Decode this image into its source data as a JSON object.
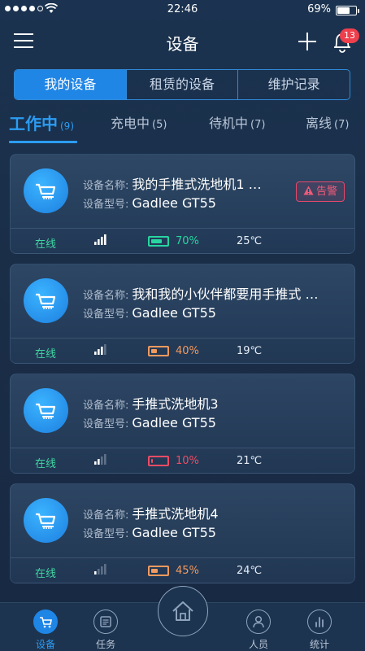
{
  "status_bar": {
    "time": "22:46",
    "battery_percent": "69%",
    "battery_level": 0.69
  },
  "header": {
    "title": "设备",
    "notification_count": "13"
  },
  "segment": [
    {
      "label": "我的设备",
      "active": true
    },
    {
      "label": "租赁的设备",
      "active": false
    },
    {
      "label": "维护记录",
      "active": false
    }
  ],
  "tabs": [
    {
      "label": "工作中",
      "count": "(9)",
      "active": true
    },
    {
      "label": "充电中",
      "count": "(5)",
      "active": false
    },
    {
      "label": "待机中",
      "count": "(7)",
      "active": false
    },
    {
      "label": "离线",
      "count": "(7)",
      "active": false
    }
  ],
  "labels": {
    "name": "设备名称:",
    "model": "设备型号:"
  },
  "devices": [
    {
      "name": "我的手推式洗地机1 …",
      "model": "Gadlee GT55",
      "status": "在线",
      "alarm": "告警",
      "battery": "70%",
      "battery_level": 0.7,
      "battery_color": "#27d6a0",
      "signal": 4,
      "temp": "25℃"
    },
    {
      "name": "我和我的小伙伴都要用手推式 …",
      "model": "Gadlee GT55",
      "status": "在线",
      "alarm": "",
      "battery": "40%",
      "battery_level": 0.4,
      "battery_color": "#f39a5e",
      "signal": 3,
      "temp": "19℃"
    },
    {
      "name": "手推式洗地机3",
      "model": "Gadlee GT55",
      "status": "在线",
      "alarm": "",
      "battery": "10%",
      "battery_level": 0.1,
      "battery_color": "#ef4c63",
      "signal": 2,
      "temp": "21℃"
    },
    {
      "name": "手推式洗地机4",
      "model": "Gadlee GT55",
      "status": "在线",
      "alarm": "",
      "battery": "45%",
      "battery_level": 0.45,
      "battery_color": "#f39a5e",
      "signal": 1,
      "temp": "24℃"
    }
  ],
  "bottom_nav": [
    {
      "label": "设备",
      "icon": "cart-icon",
      "active": true
    },
    {
      "label": "任务",
      "icon": "task-icon",
      "active": false
    },
    {
      "label": "人员",
      "icon": "person-icon",
      "active": false
    },
    {
      "label": "统计",
      "icon": "stats-icon",
      "active": false
    }
  ],
  "colors": {
    "accent": "#1f86e6",
    "online": "#3fd7a2",
    "alarm": "#e8476a"
  }
}
